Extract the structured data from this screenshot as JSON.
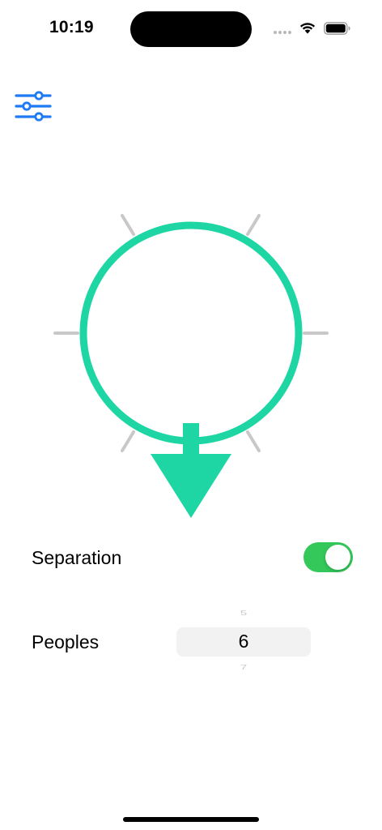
{
  "status_bar": {
    "time": "10:19"
  },
  "toolbar": {
    "settings_icon": "sliders-icon"
  },
  "compass": {
    "ring_color": "#1dd6a4",
    "tick_color": "#c8c8c8",
    "arrow_direction": "down"
  },
  "settings": {
    "separation_label": "Separation",
    "separation_enabled": true,
    "toggle_color": "#34c759",
    "peoples_label": "Peoples",
    "peoples_picker": {
      "previous": "5",
      "selected": "6",
      "next": "7"
    }
  },
  "colors": {
    "accent": "#1e7bf5",
    "compass": "#1dd6a4"
  }
}
